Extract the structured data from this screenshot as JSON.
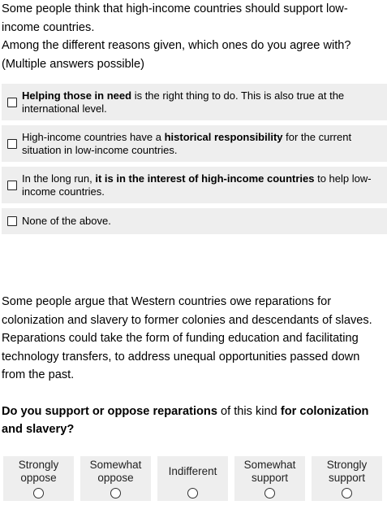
{
  "intro": {
    "line1": "Some people think that high-income countries should support low-income countries.",
    "line2": "Among the different reasons given, which ones do you agree with?",
    "line3": "(Multiple answers possible)"
  },
  "options": [
    {
      "bold_before": "",
      "text_before": "",
      "bold": "Helping those in need",
      "text_after": " is the right thing to do. This is also true at the international level."
    },
    {
      "text_before": "High-income countries have a ",
      "bold": "historical responsibility",
      "text_after": " for the current situation in low-income countries."
    },
    {
      "text_before": "In the long run, ",
      "bold": "it is in the interest of high-income countries",
      "text_after": " to help low-income countries."
    },
    {
      "text_before": "None of the above.",
      "bold": "",
      "text_after": ""
    }
  ],
  "question2": {
    "paragraph": "Some people argue that Western countries owe reparations for colonization and slavery to former colonies and descendants of slaves. Reparations could take the form of funding education and facilitating technology transfers, to address unequal opportunities passed down from the past.",
    "q_bold1": "Do you support or oppose reparations",
    "q_mid": " of this kind ",
    "q_bold2": "for colonization and slavery?"
  },
  "scale": [
    {
      "label": "Strongly oppose"
    },
    {
      "label": "Somewhat oppose"
    },
    {
      "label": "Indifferent"
    },
    {
      "label": "Somewhat support"
    },
    {
      "label": "Strongly support"
    }
  ]
}
